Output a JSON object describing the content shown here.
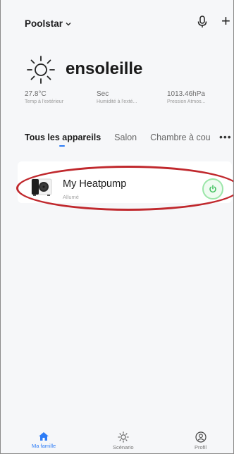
{
  "header": {
    "home_name": "Poolstar"
  },
  "weather": {
    "condition": "ensoleille",
    "stats": [
      {
        "value": "27.8°C",
        "label": "Temp à l'extérieur"
      },
      {
        "value": "Sec",
        "label": "Humidité à l'exté..."
      },
      {
        "value": "1013.46hPa",
        "label": "Pression Atmos..."
      }
    ]
  },
  "tabs": [
    {
      "label": "Tous les appareils"
    },
    {
      "label": "Salon"
    },
    {
      "label": "Chambre à cou"
    }
  ],
  "device": {
    "name": "My Heatpump",
    "status": "Allumé"
  },
  "nav": [
    {
      "label": "Ma famille",
      "icon": "home-icon"
    },
    {
      "label": "Scénario",
      "icon": "sun-icon"
    },
    {
      "label": "Profil",
      "icon": "profile-icon"
    }
  ],
  "colors": {
    "accent": "#2d7cf6",
    "power_green": "#3bbf5a",
    "highlight_red": "#c0282d"
  }
}
